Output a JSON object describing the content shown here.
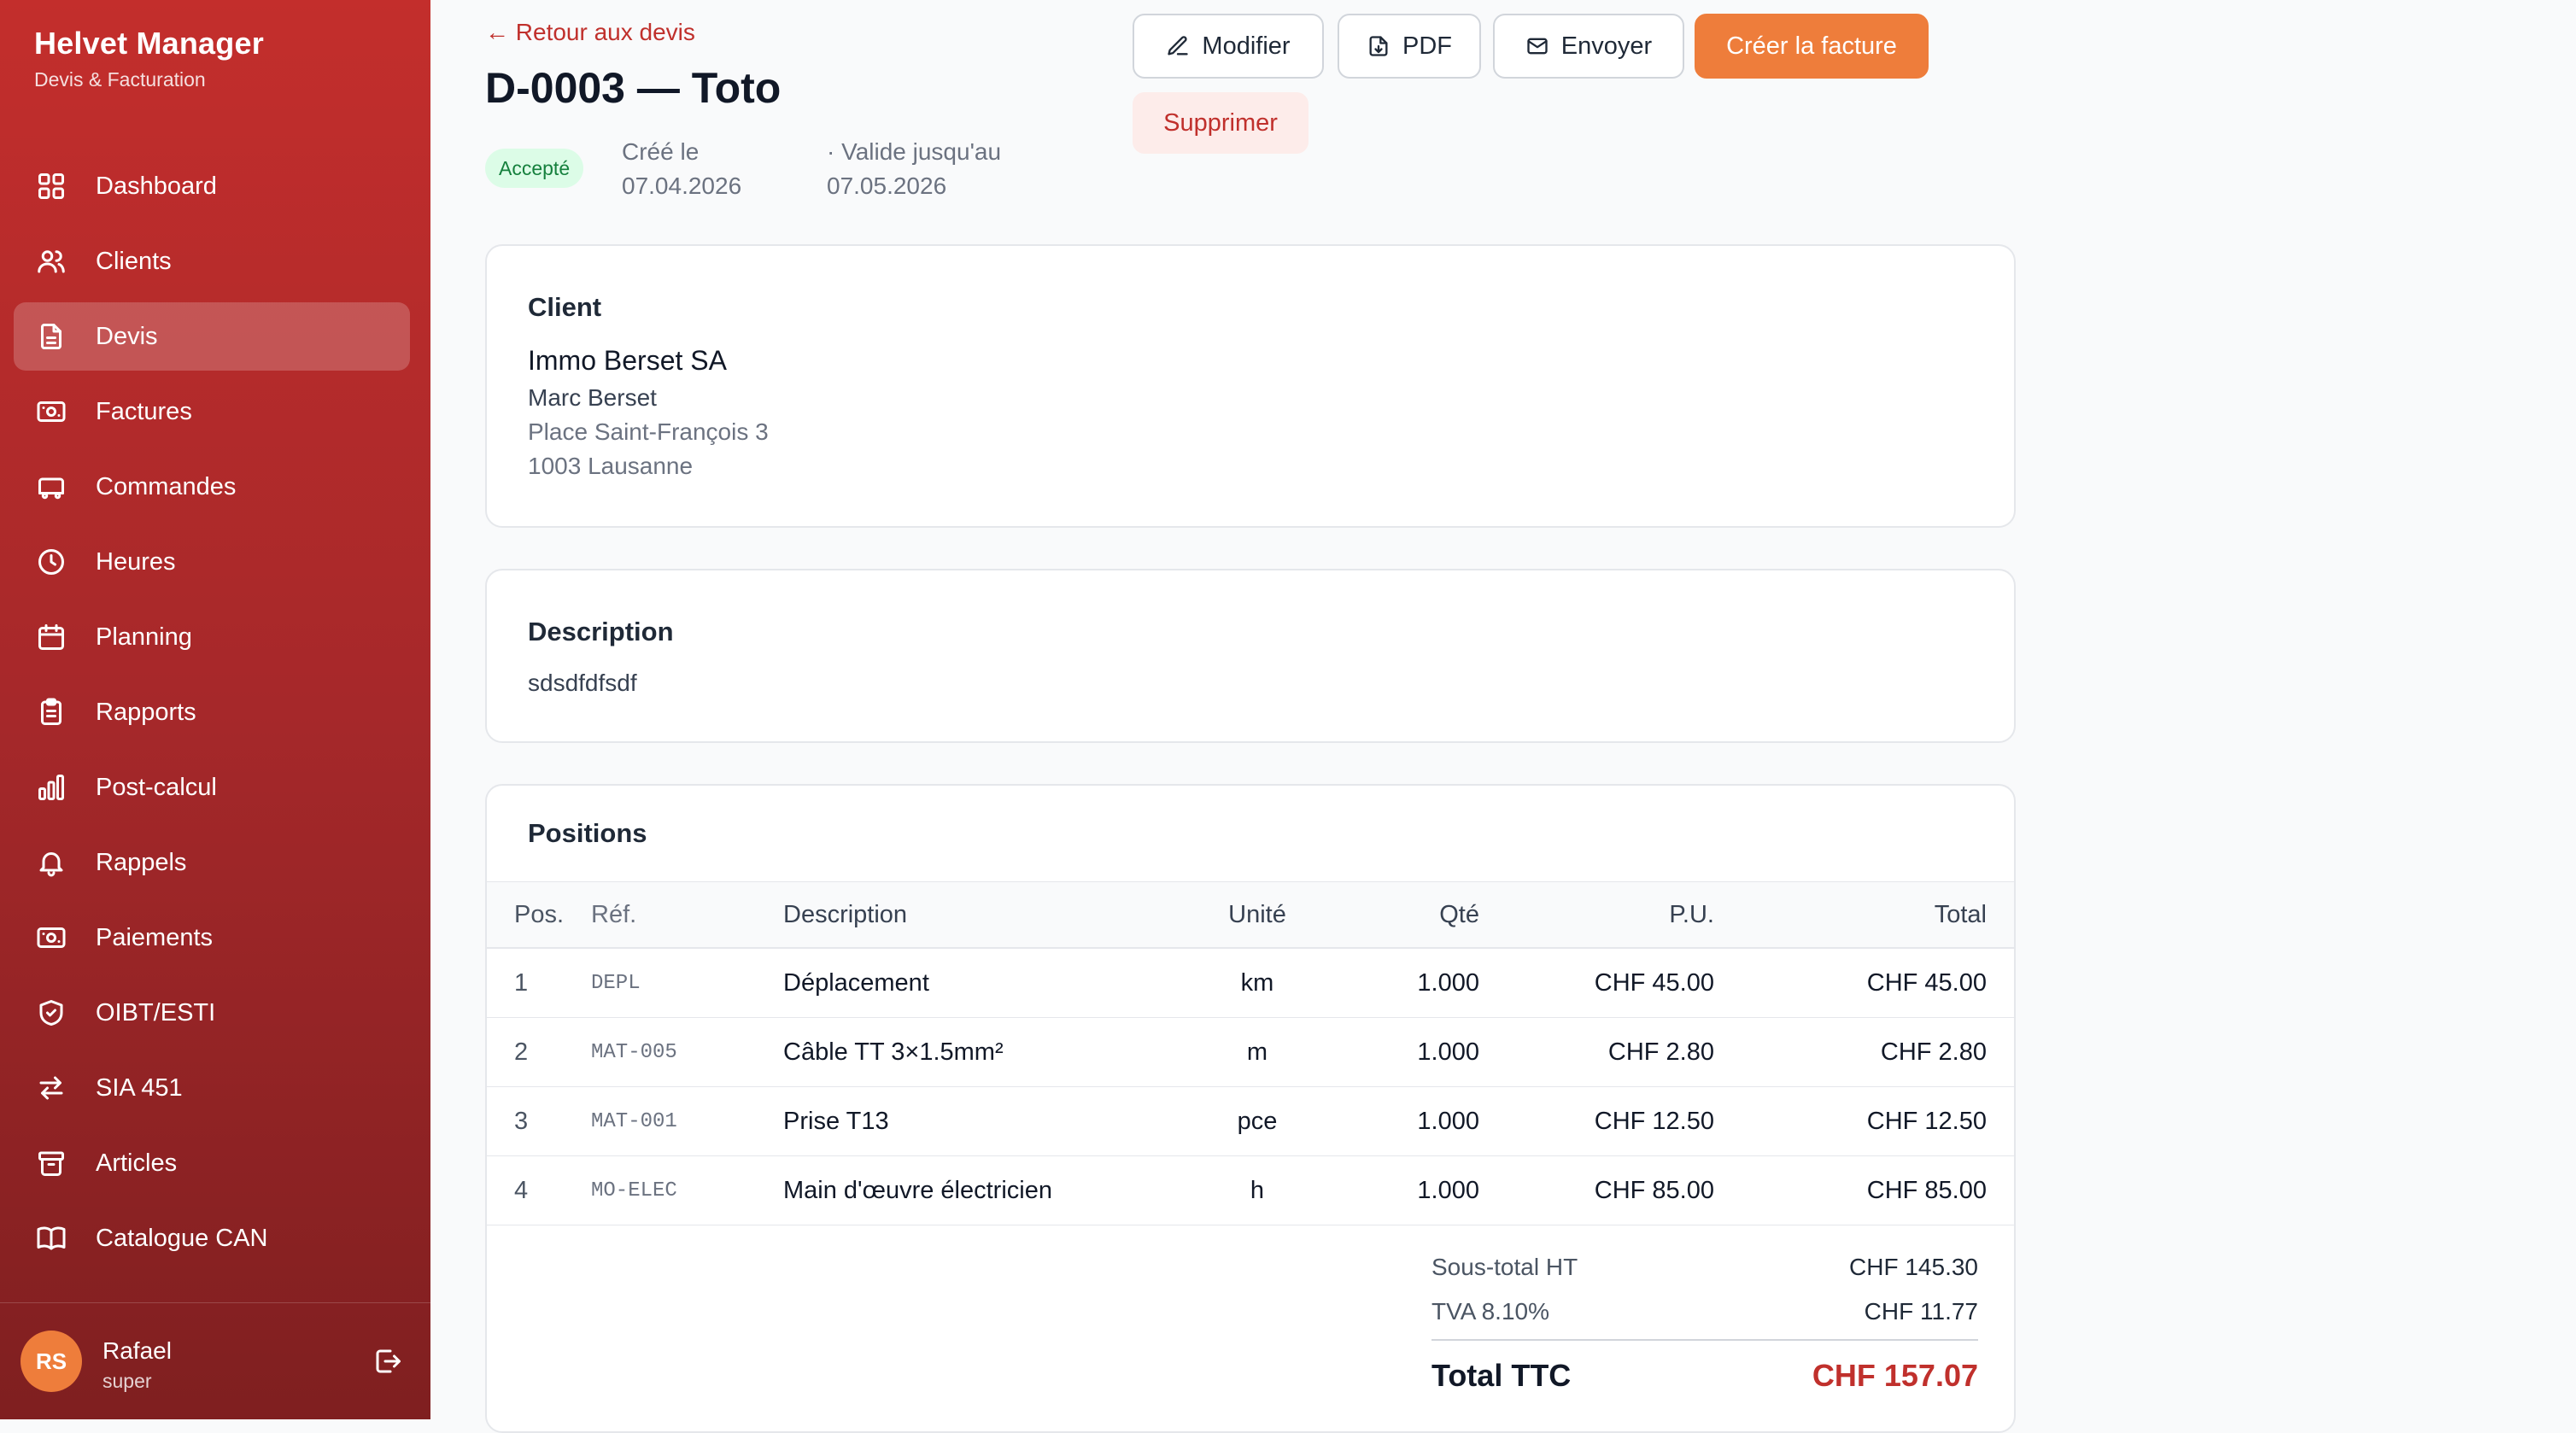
{
  "sidebar": {
    "brand_title": "Helvet Manager",
    "brand_subtitle": "Devis & Facturation",
    "items": [
      {
        "label": "Dashboard",
        "icon": "grid-icon"
      },
      {
        "label": "Clients",
        "icon": "users-icon"
      },
      {
        "label": "Devis",
        "icon": "document-icon",
        "active": true
      },
      {
        "label": "Factures",
        "icon": "banknote-icon"
      },
      {
        "label": "Commandes",
        "icon": "truck-icon"
      },
      {
        "label": "Heures",
        "icon": "clock-icon"
      },
      {
        "label": "Planning",
        "icon": "calendar-icon"
      },
      {
        "label": "Rapports",
        "icon": "clipboard-icon"
      },
      {
        "label": "Post-calcul",
        "icon": "bar-chart-icon"
      },
      {
        "label": "Rappels",
        "icon": "bell-icon"
      },
      {
        "label": "Paiements",
        "icon": "banknote-icon"
      },
      {
        "label": "OIBT/ESTI",
        "icon": "shield-check-icon"
      },
      {
        "label": "SIA 451",
        "icon": "arrows-left-right-icon"
      },
      {
        "label": "Articles",
        "icon": "archive-icon"
      },
      {
        "label": "Catalogue CAN",
        "icon": "book-icon"
      }
    ],
    "user": {
      "initials": "RS",
      "name": "Rafael",
      "role": "super"
    }
  },
  "header": {
    "back_link": "← Retour aux devis",
    "title": "D-0003 — Toto",
    "status": "Accepté",
    "created": "Créé le 07.04.2026",
    "valid_until": "· Valide jusqu'au 07.05.2026"
  },
  "actions": {
    "modifier": "Modifier",
    "pdf": "PDF",
    "envoyer": "Envoyer",
    "creer_facture": "Créer la facture",
    "supprimer": "Supprimer"
  },
  "client": {
    "heading": "Client",
    "company": "Immo Berset SA",
    "contact": "Marc Berset",
    "street": "Place Saint-François 3",
    "city": "1003 Lausanne"
  },
  "description": {
    "heading": "Description",
    "text": "sdsdfdfsdf"
  },
  "positions": {
    "heading": "Positions",
    "columns": [
      "Pos.",
      "Réf.",
      "Description",
      "Unité",
      "Qté",
      "P.U.",
      "Total"
    ],
    "rows": [
      [
        "1",
        "DEPL",
        "Déplacement",
        "km",
        "1.000",
        "CHF 45.00",
        "CHF 45.00"
      ],
      [
        "2",
        "MAT-005",
        "Câble TT 3×1.5mm²",
        "m",
        "1.000",
        "CHF 2.80",
        "CHF 2.80"
      ],
      [
        "3",
        "MAT-001",
        "Prise T13",
        "pce",
        "1.000",
        "CHF 12.50",
        "CHF 12.50"
      ],
      [
        "4",
        "MO-ELEC",
        "Main d'œuvre électricien",
        "h",
        "1.000",
        "CHF 85.00",
        "CHF 85.00"
      ]
    ],
    "subtotal_label": "Sous-total HT",
    "subtotal_value": "CHF 145.30",
    "vat_label": "TVA 8.10%",
    "vat_value": "CHF 11.77",
    "total_label": "Total TTC",
    "total_value": "CHF 157.07"
  },
  "colors": {
    "brand_red": "#c32e2c",
    "accent_orange": "#ee7d3b",
    "success_green": "#15803d"
  }
}
